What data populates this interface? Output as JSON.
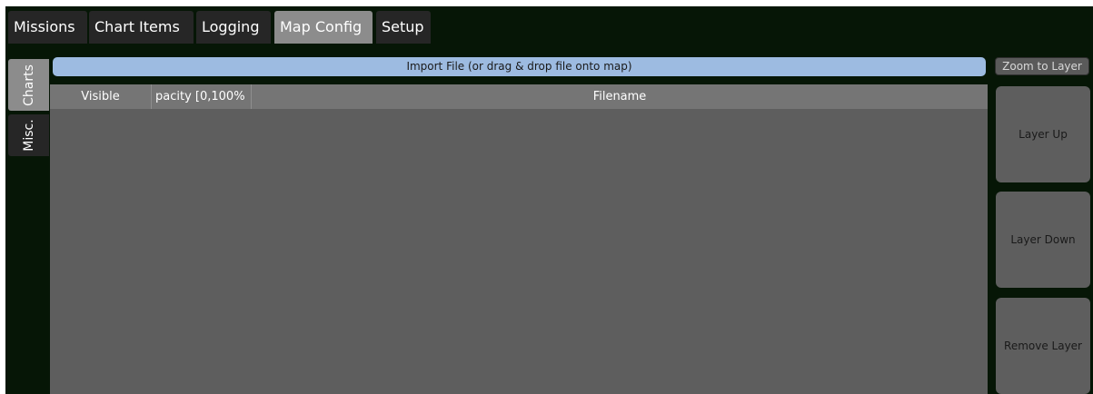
{
  "tabs": [
    {
      "label": "Missions",
      "active": false
    },
    {
      "label": "Chart Items",
      "active": false
    },
    {
      "label": "Logging",
      "active": false
    },
    {
      "label": "Map Config",
      "active": true
    },
    {
      "label": "Setup",
      "active": false
    }
  ],
  "side_tabs": [
    {
      "label": "Charts",
      "active": true
    },
    {
      "label": "Misc.",
      "active": false
    }
  ],
  "import_bar": {
    "label": "Import File (or drag & drop file onto map)"
  },
  "table": {
    "columns": [
      "Visible",
      "pacity [0,100%",
      "Filename"
    ],
    "rows": []
  },
  "buttons": {
    "zoom_to_layer": "Zoom to Layer",
    "layer_up": "Layer Up",
    "layer_down": "Layer Down",
    "remove_layer": "Remove Layer"
  },
  "colors": {
    "background": "#061606",
    "active_tab": "#8c8c8c",
    "inactive_tab": "#262626",
    "import_bar": "#9dbbe1",
    "table_body": "#5e5e5e",
    "table_header": "#757575"
  }
}
